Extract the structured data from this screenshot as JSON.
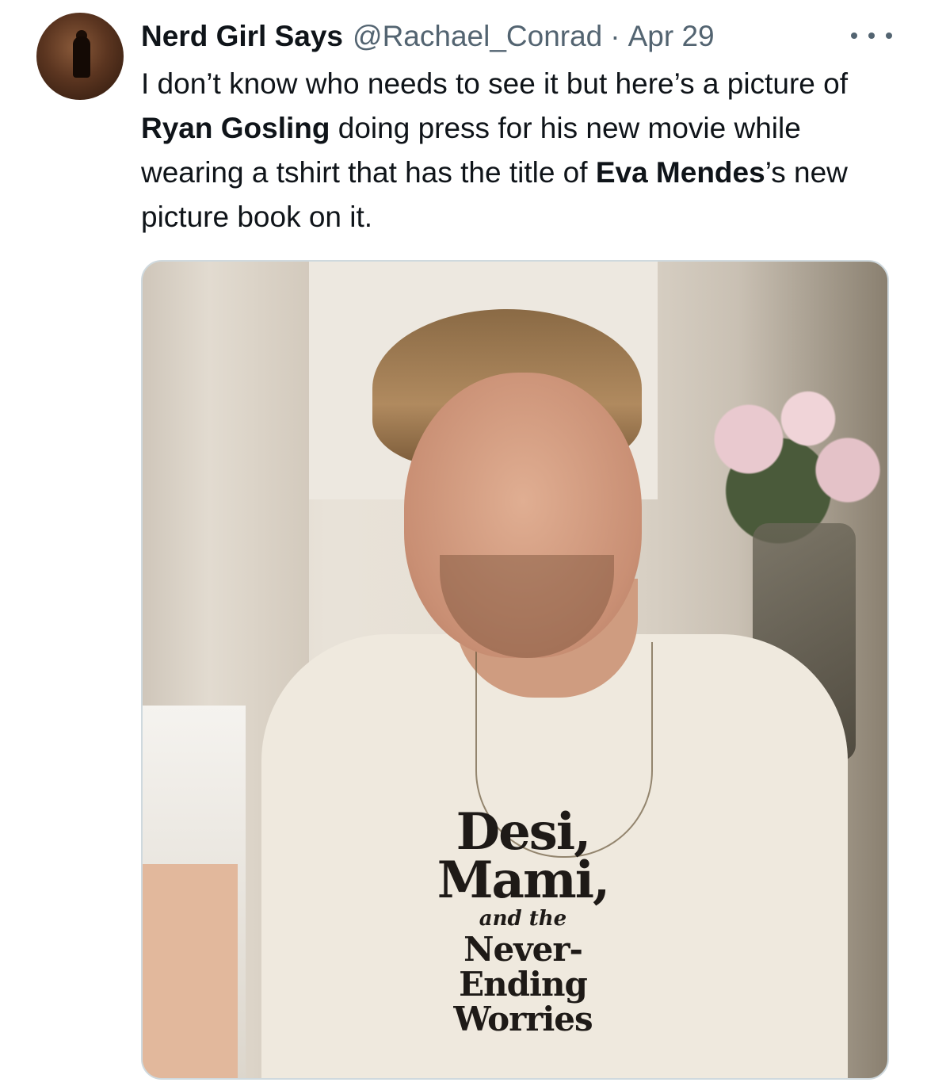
{
  "tweet": {
    "display_name": "Nerd Girl Says",
    "handle": "@Rachael_Conrad",
    "separator": "·",
    "date": "Apr 29",
    "text_parts": [
      "I don’t know who needs to see it but here’s a picture of ",
      "Ryan Gosling",
      " doing press for his new movie while wearing a tshirt that has the title of ",
      "Eva Mendes",
      "’s new picture book on it."
    ]
  },
  "media": {
    "shirt_lines": [
      "Desi,",
      "Mami,",
      "and the",
      "Never-Ending",
      "Worries"
    ]
  },
  "icons": {
    "more": "more-horizontal-icon",
    "avatar": "avatar-image"
  },
  "colors": {
    "text_primary": "#0f1419",
    "text_secondary": "#536471",
    "border": "#cfd9de"
  }
}
